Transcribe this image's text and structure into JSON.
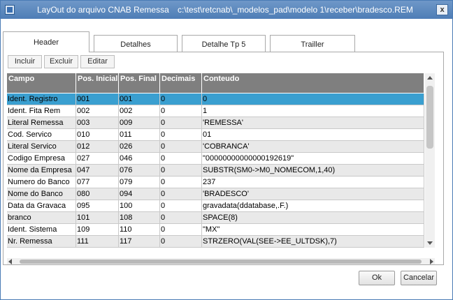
{
  "window": {
    "title": "LayOut do arquivo CNAB Remessa",
    "path": "c:\\test\\retcnab\\_modelos_pad\\modelo 1\\receber\\bradesco.REM",
    "close_label": "x"
  },
  "tabs": [
    {
      "label": "Header",
      "active": true
    },
    {
      "label": "Detalhes",
      "active": false
    },
    {
      "label": "Detalhe Tp 5",
      "active": false
    },
    {
      "label": "Trailler",
      "active": false
    }
  ],
  "toolbar": {
    "incluir": "Incluir",
    "excluir": "Excluir",
    "editar": "Editar"
  },
  "grid": {
    "columns": [
      "Campo",
      "Pos. Inicial",
      "Pos. Final",
      "Decimais",
      "Conteudo"
    ],
    "rows": [
      [
        "Ident. Registro",
        "001",
        "001",
        "0",
        "0"
      ],
      [
        "Ident. Fita Rem",
        "002",
        "002",
        "0",
        "1"
      ],
      [
        "Literal Remessa",
        "003",
        "009",
        "0",
        "'REMESSA'"
      ],
      [
        "Cod. Servico",
        "010",
        "011",
        "0",
        "01"
      ],
      [
        "Literal Servico",
        "012",
        "026",
        "0",
        "'COBRANCA'"
      ],
      [
        "Codigo Empresa",
        "027",
        "046",
        "0",
        "\"00000000000000192619\""
      ],
      [
        "Nome da Empresa",
        "047",
        "076",
        "0",
        "SUBSTR(SM0->M0_NOMECOM,1,40)"
      ],
      [
        "Numero do Banco",
        "077",
        "079",
        "0",
        "237"
      ],
      [
        "Nome do Banco",
        "080",
        "094",
        "0",
        "'BRADESCO'"
      ],
      [
        "Data da Gravaca",
        "095",
        "100",
        "0",
        "gravadata(ddatabase,.F.)"
      ],
      [
        "branco",
        "101",
        "108",
        "0",
        "SPACE(8)"
      ],
      [
        "Ident. Sistema",
        "109",
        "110",
        "0",
        "\"MX\""
      ],
      [
        "Nr. Remessa",
        "111",
        "117",
        "0",
        "STRZERO(VAL(SEE->EE_ULTDSK),7)"
      ]
    ],
    "selected_row": 0
  },
  "buttons": {
    "ok": "Ok",
    "cancel": "Cancelar"
  },
  "colors": {
    "titlebar": "#4e7db6",
    "header": "#7f7f7f",
    "selection": "#3a9fd0"
  }
}
